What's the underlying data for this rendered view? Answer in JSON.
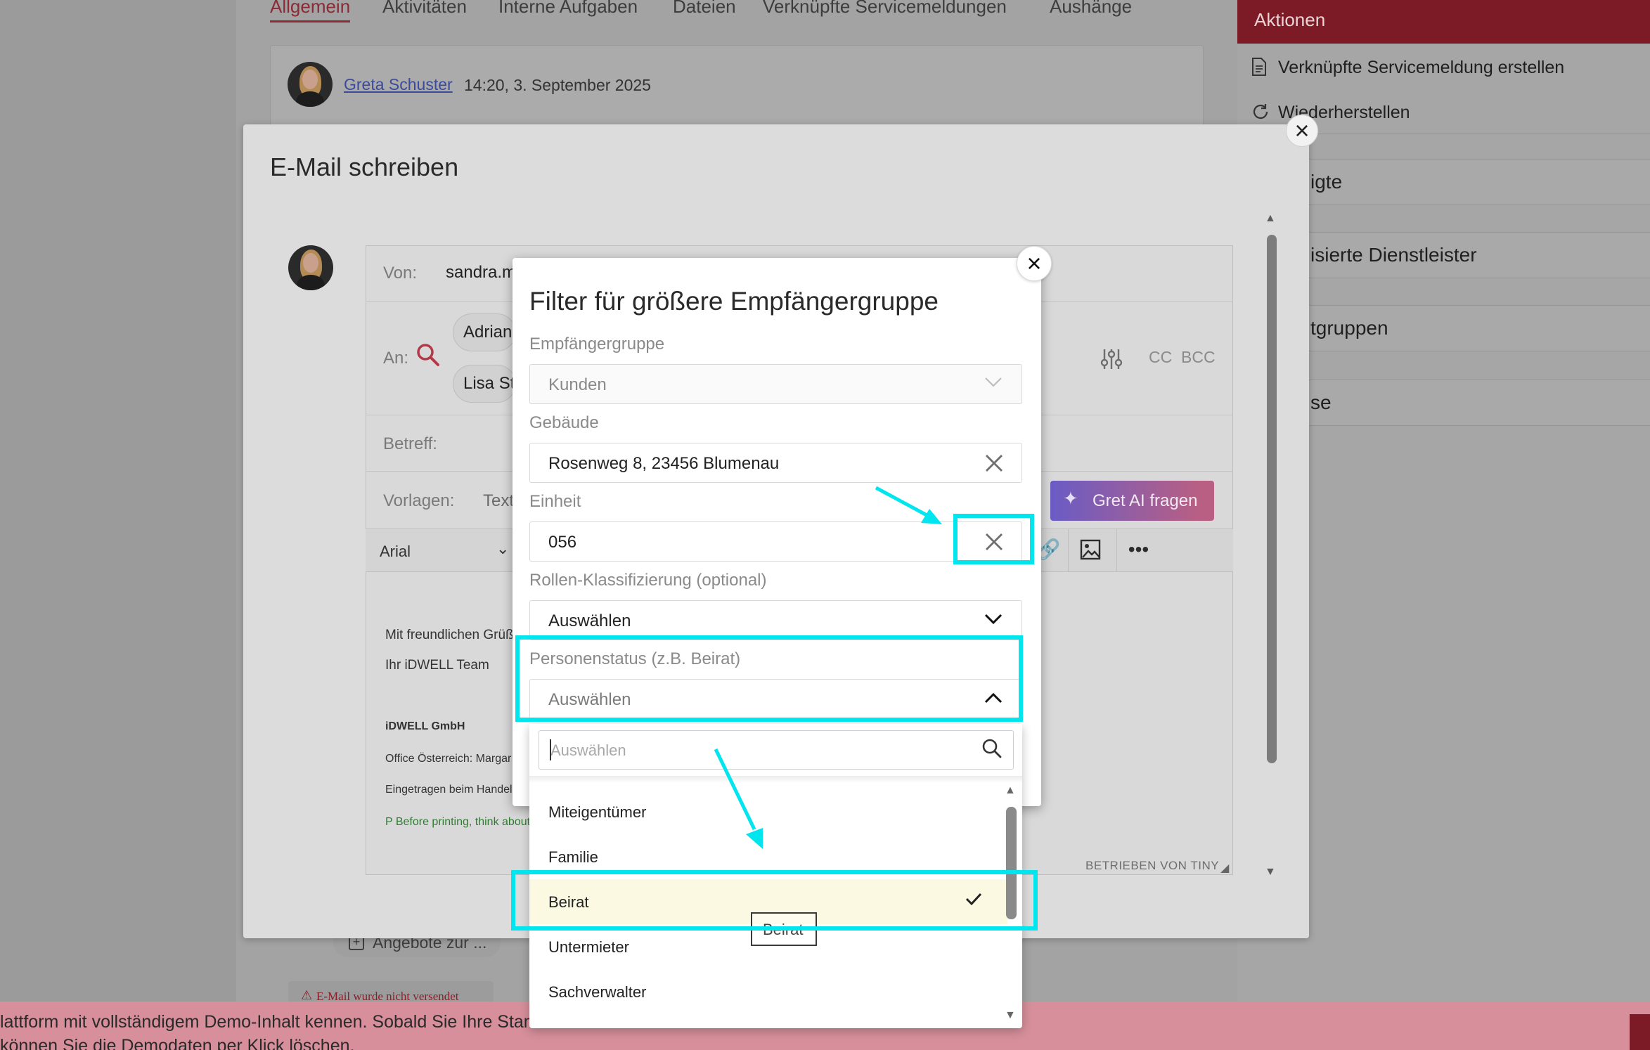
{
  "background": {
    "tabs": [
      "Allgemein",
      "Aktivitäten",
      "Interne Aufgaben",
      "Dateien",
      "Verknüpfte Servicemeldungen",
      "Aushänge"
    ],
    "activity": {
      "author": "Greta Schuster",
      "time": "14:20, 3. September 2025"
    },
    "offers_chip": "Angebote zur ...",
    "not_sent": "E-Mail wurde nicht versendet",
    "demo_banner": {
      "line1": "lattform mit vollständigem Demo-Inhalt kennen. Sobald Sie Ihre Stammdaten",
      "line2": "können Sie die Demodaten per Klick löschen."
    }
  },
  "actions": {
    "header": "Aktionen",
    "items": [
      "Verknüpfte Servicemeldung erstellen",
      "Wiederherstellen"
    ],
    "sections": [
      "igte",
      "isierte Dienstleister",
      "tgruppen",
      "se"
    ]
  },
  "email": {
    "title": "E-Mail schreiben",
    "from_label": "Von:",
    "from_value": "sandra.m",
    "to_label": "An:",
    "recipients": [
      "Adrian",
      "Lisa St"
    ],
    "cc": "CC",
    "bcc": "BCC",
    "subject_label": "Betreff:",
    "templates_label": "Vorlagen:",
    "templates_value": "Text",
    "ai_button": "Gret AI fragen",
    "font": "Arial",
    "body": [
      "Mit freundlichen Grüß",
      "Ihr iDWELL Team",
      "iDWELL GmbH",
      "Office Österreich: Margar",
      "Eingetragen beim Handel",
      "P Before printing, think about"
    ],
    "branding": "BETRIEBEN VON TINY"
  },
  "filter": {
    "title": "Filter für größere Empfängergruppe",
    "fields": {
      "group": {
        "label": "Empfängergruppe",
        "value": "Kunden"
      },
      "building": {
        "label": "Gebäude",
        "value": "Rosenweg 8, 23456 Blumenau"
      },
      "unit": {
        "label": "Einheit",
        "value": "056"
      },
      "role": {
        "label": "Rollen-Klassifizierung (optional)",
        "value": "Auswählen"
      },
      "status": {
        "label": "Personenstatus (z.B. Beirat)",
        "value": "Auswählen"
      }
    },
    "dropdown": {
      "search_placeholder": "Auswählen",
      "options": [
        "Miteigentümer",
        "Familie",
        "Beirat",
        "Untermieter",
        "Sachverwalter"
      ],
      "selected": "Beirat",
      "drag_label": "Beirat"
    }
  },
  "colors": {
    "brand": "#7c1a26",
    "highlight": "#00e5ee",
    "selected_row": "#fbf9e2"
  }
}
